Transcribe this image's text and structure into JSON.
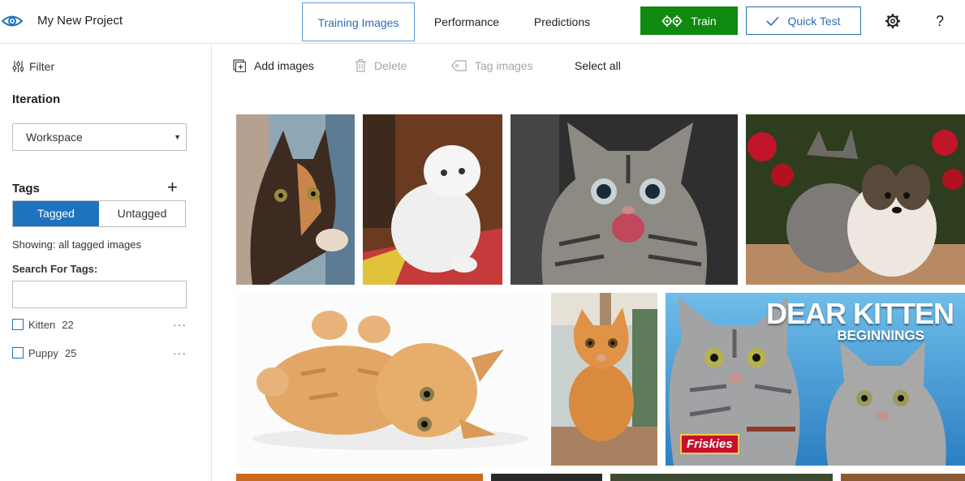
{
  "header": {
    "project_name": "My New Project",
    "tabs": [
      {
        "label": "Training Images",
        "active": true
      },
      {
        "label": "Performance",
        "active": false
      },
      {
        "label": "Predictions",
        "active": false
      }
    ],
    "train_label": "Train",
    "quick_test_label": "Quick Test",
    "help_label": "?"
  },
  "sidebar": {
    "filter_label": "Filter",
    "iteration_title": "Iteration",
    "iteration_value": "Workspace",
    "tags_title": "Tags",
    "toggle": {
      "tagged": "Tagged",
      "untagged": "Untagged",
      "selected": "tagged"
    },
    "showing_text": "Showing: all tagged images",
    "search_label": "Search For Tags:",
    "search_value": "",
    "tags": [
      {
        "name": "Kitten",
        "count": "22",
        "more": "···"
      },
      {
        "name": "Puppy",
        "count": "25",
        "more": "···"
      }
    ]
  },
  "toolbar": {
    "add_images": "Add images",
    "delete": "Delete",
    "tag_images": "Tag images",
    "select_all": "Select all"
  },
  "images": {
    "dear_kitten_title": "DEAR KITTEN",
    "dear_kitten_subtitle": "BEGINNINGS",
    "friskies_logo": "Friskies"
  },
  "colors": {
    "accent": "#1e73be",
    "train_green": "#0f8a0f",
    "tab_border": "#5a9fd6"
  }
}
